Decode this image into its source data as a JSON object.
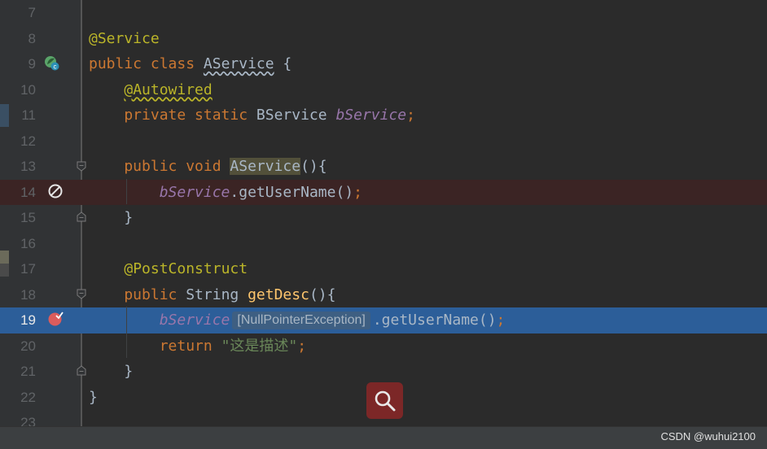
{
  "editor": {
    "lines": [
      {
        "num": "7",
        "tokens": []
      },
      {
        "num": "8",
        "tokens": [
          {
            "t": "@Service",
            "c": "ann"
          }
        ]
      },
      {
        "num": "9",
        "tokens": [
          {
            "t": "public class ",
            "c": "kw"
          },
          {
            "t": "AService",
            "c": "plain squig"
          },
          {
            "t": " {",
            "c": "plain"
          }
        ]
      },
      {
        "num": "10",
        "tokens": [
          {
            "t": "    ",
            "c": "plain"
          },
          {
            "t": "@Autowired",
            "c": "ann squig-y"
          }
        ]
      },
      {
        "num": "11",
        "tokens": [
          {
            "t": "    private static ",
            "c": "kw"
          },
          {
            "t": "BService ",
            "c": "plain"
          },
          {
            "t": "bService",
            "c": "fld"
          },
          {
            "t": ";",
            "c": "kw"
          }
        ]
      },
      {
        "num": "12",
        "tokens": []
      },
      {
        "num": "13",
        "tokens": [
          {
            "t": "    public void ",
            "c": "kw"
          },
          {
            "t": "AService",
            "c": "plain hl"
          },
          {
            "t": "(){",
            "c": "plain"
          }
        ]
      },
      {
        "num": "14",
        "tokens": [
          {
            "t": "        ",
            "c": "plain"
          },
          {
            "t": "bService",
            "c": "fld"
          },
          {
            "t": ".getUserName()",
            "c": "plain"
          },
          {
            "t": ";",
            "c": "kw"
          }
        ]
      },
      {
        "num": "15",
        "tokens": [
          {
            "t": "    }",
            "c": "plain"
          }
        ]
      },
      {
        "num": "16",
        "tokens": []
      },
      {
        "num": "17",
        "tokens": [
          {
            "t": "    ",
            "c": "plain"
          },
          {
            "t": "@PostConstruct",
            "c": "ann"
          }
        ]
      },
      {
        "num": "18",
        "tokens": [
          {
            "t": "    public ",
            "c": "kw"
          },
          {
            "t": "String ",
            "c": "plain"
          },
          {
            "t": "getDesc",
            "c": "fn"
          },
          {
            "t": "(){",
            "c": "plain"
          }
        ]
      },
      {
        "num": "19",
        "tokens": [
          {
            "t": "        ",
            "c": "plain"
          },
          {
            "t": "bService",
            "c": "fld"
          },
          {
            "t": "[NullPointerException]",
            "c": "inlay"
          },
          {
            "t": ".getUserName()",
            "c": "plain"
          },
          {
            "t": ";",
            "c": "kw"
          }
        ]
      },
      {
        "num": "20",
        "tokens": [
          {
            "t": "        return ",
            "c": "kw"
          },
          {
            "t": "\"这是描述\"",
            "c": "str"
          },
          {
            "t": ";",
            "c": "kw"
          }
        ]
      },
      {
        "num": "21",
        "tokens": [
          {
            "t": "    }",
            "c": "plain"
          }
        ]
      },
      {
        "num": "22",
        "tokens": [
          {
            "t": "}",
            "c": "plain"
          }
        ]
      },
      {
        "num": "23",
        "tokens": []
      }
    ]
  },
  "gutter_icons": {
    "line9": "spring-bean-icon",
    "line14": "disabled-breakpoint-icon",
    "line19": "exception-breakpoint-icon"
  },
  "colors": {
    "background": "#2b2b2b",
    "current_line": "#2c5e99",
    "error_line": "#3b2424",
    "keyword": "#cc7832",
    "annotation": "#bbb529",
    "field": "#9876aa",
    "method": "#ffc66d",
    "string": "#6a8759"
  },
  "status": {
    "watermark": "CSDN @wuhui2100"
  },
  "search_button": {
    "icon": "search-icon"
  }
}
